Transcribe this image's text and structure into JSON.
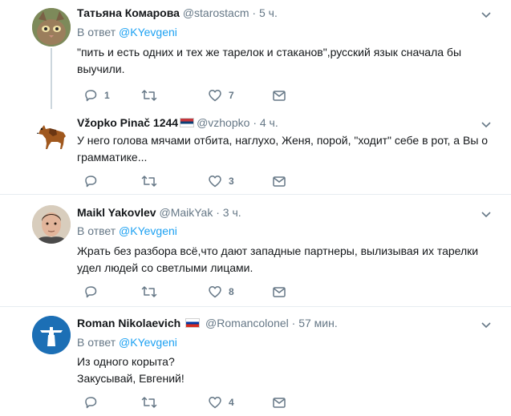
{
  "tweets": [
    {
      "name": "Татьяна Комарова",
      "handle": "@starostacm",
      "time": "5 ч.",
      "reply_prefix": "В ответ",
      "reply_mention": "@KYevgeni",
      "text": "\"пить и есть одних и тех же тарелок и стаканов\",русский язык сначала бы выучили.",
      "replies": "1",
      "retweets": "",
      "likes": "7"
    },
    {
      "name": "Vžopko Pinač 1244",
      "handle": "@vzhopko",
      "time": "4 ч.",
      "flag": "serbia-flag",
      "text": "У него голова мячами отбита, наглухо, Женя, порой, \"ходит\" себе в рот, а Вы о грамматике...",
      "replies": "",
      "retweets": "",
      "likes": "3"
    },
    {
      "name": "Maikl Yakovlev",
      "handle": "@MaikYak",
      "time": "3 ч.",
      "reply_prefix": "В ответ",
      "reply_mention": "@KYevgeni",
      "text": "Жрать без разбора всё,что дают западные партнеры, вылизывая их тарелки удел людей со светлыми лицами.",
      "replies": "",
      "retweets": "",
      "likes": "8"
    },
    {
      "name": "Roman Nikolaevich",
      "handle": "@Romancolonel",
      "time": "57 мин.",
      "flag": "russia-flag",
      "reply_prefix": "В ответ",
      "reply_mention": "@KYevgeni",
      "text_lines": [
        "Из одного корыта?",
        "Закусывай, Евгений!"
      ],
      "replies": "",
      "retweets": "",
      "likes": "4"
    }
  ],
  "dot": "·",
  "colors": {
    "accent": "#1da1f2",
    "muted": "#657786",
    "text": "#14171a",
    "divider": "#e6ecf0"
  }
}
